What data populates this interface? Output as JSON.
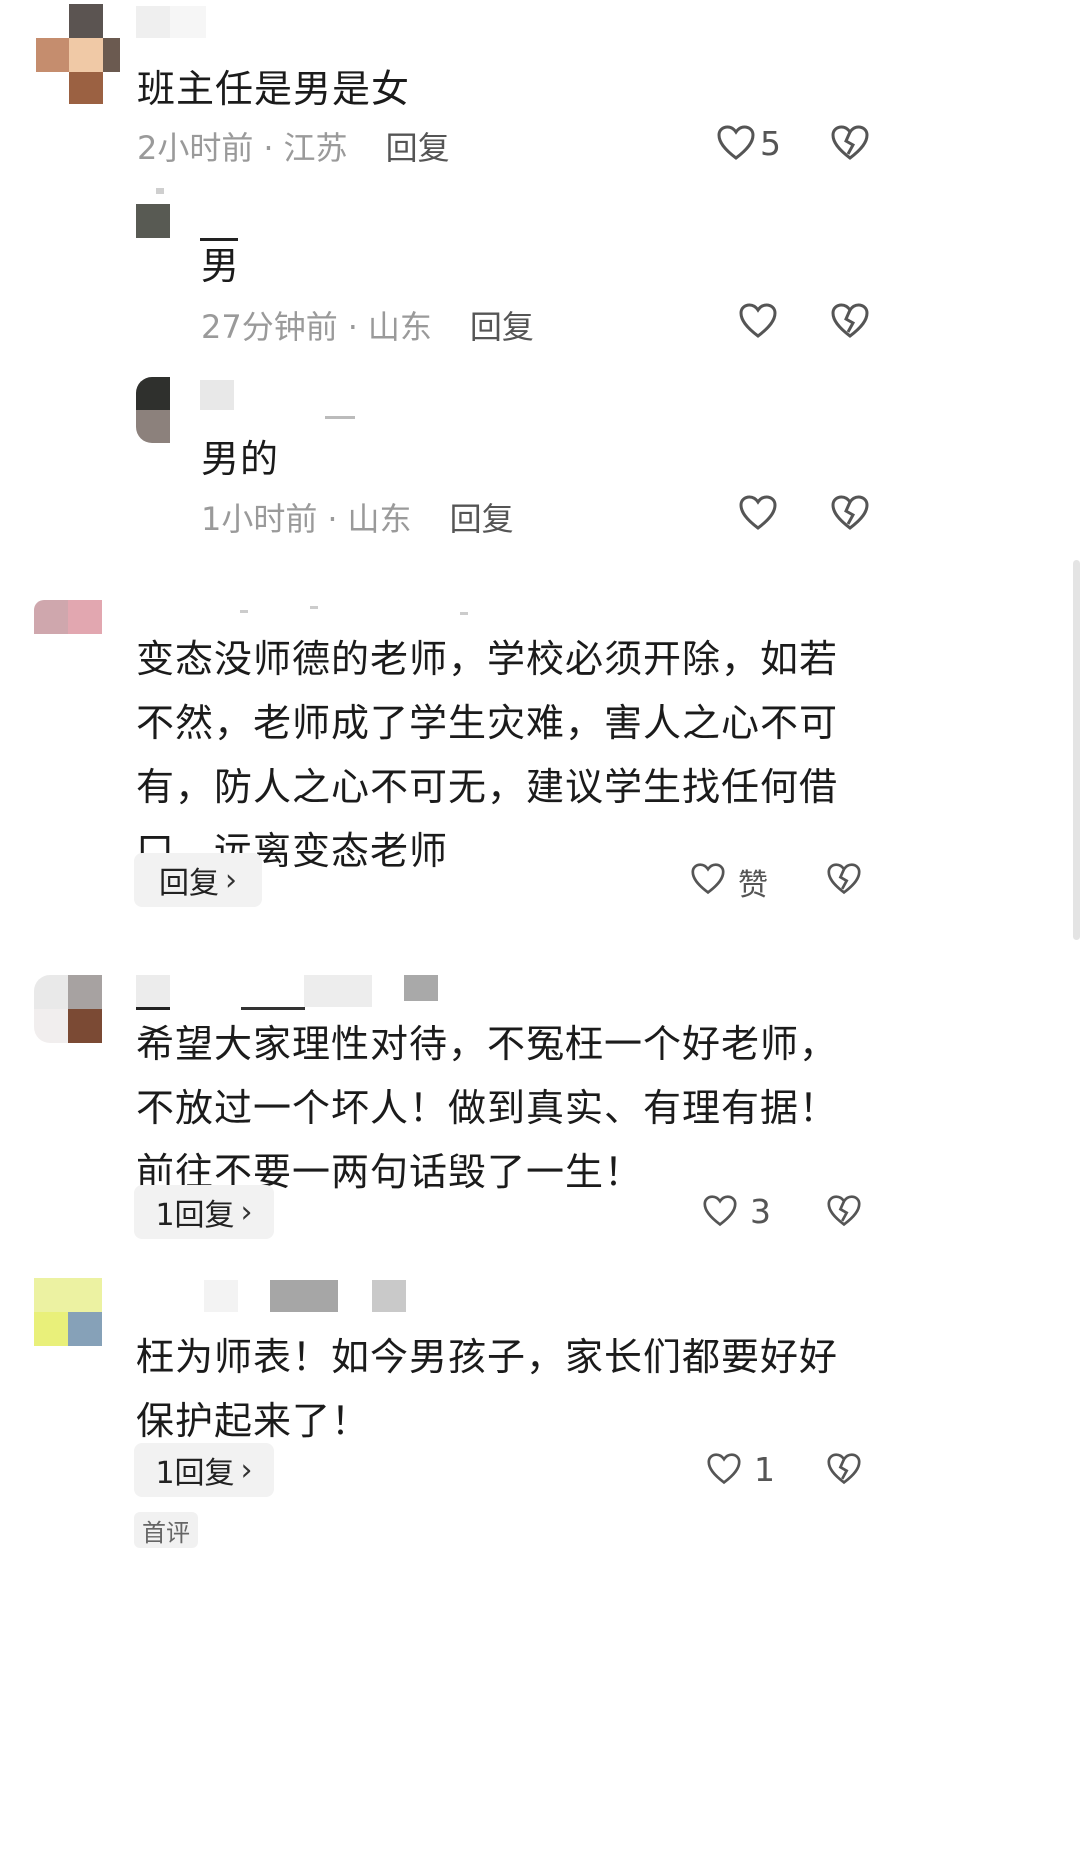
{
  "comments": [
    {
      "text": "班主任是男是女",
      "time": "2小时前",
      "location": "江苏",
      "reply_label": "回复",
      "likes": "5"
    },
    {
      "text": "男",
      "time": "27分钟前",
      "location": "山东",
      "reply_label": "回复"
    },
    {
      "text": "男的",
      "time": "1小时前",
      "location": "山东",
      "reply_label": "回复"
    },
    {
      "text": "变态没师德的老师，学校必须开除，如若不然，老师成了学生灾难，害人之心不可有，防人之心不可无，建议学生找任何借口，远离变态老师",
      "replies_label": "回复",
      "likes": "赞"
    },
    {
      "text": "希望大家理性对待，不冤枉一个好老师，不放过一个坏人！做到真实、有理有据！前往不要一两句话毁了一生！",
      "replies_label": "1回复",
      "likes": "3"
    },
    {
      "text": "枉为师表！如今男孩子，家长们都要好好保护起来了！",
      "replies_label": "1回复",
      "likes": "1",
      "tag": "首评"
    }
  ],
  "icons": {
    "like": "heart-icon",
    "dislike": "broken-heart-icon",
    "chevron": "chevron-right-icon"
  },
  "separator": "·"
}
